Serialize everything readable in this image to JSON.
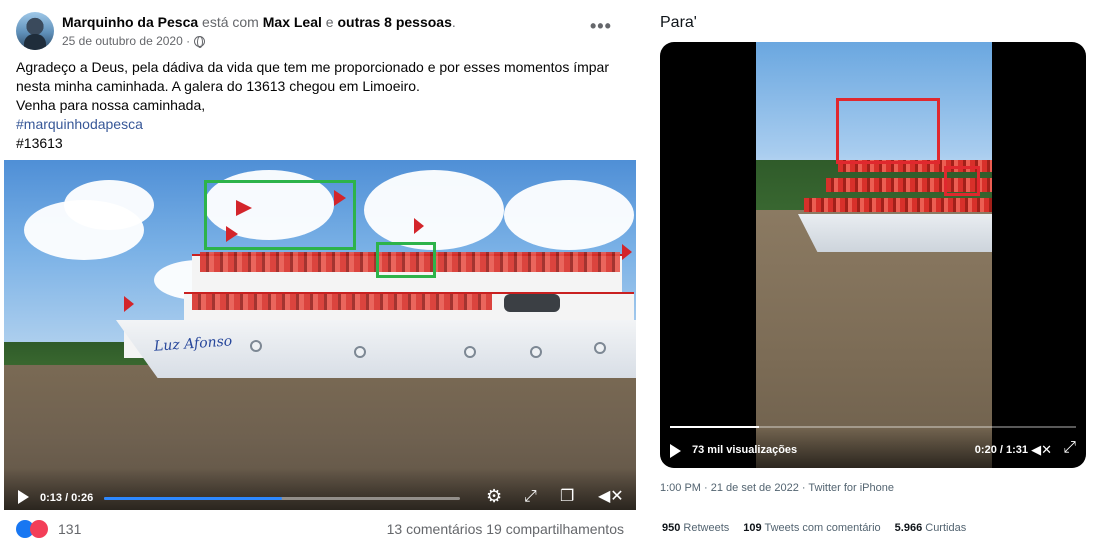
{
  "facebook_post": {
    "author": "Marquinho da Pesca",
    "with_text": "está com",
    "tagged": "Max Leal",
    "and_text": "e",
    "others": "outras 8 pessoas",
    "period": ".",
    "date": "25 de outubro de 2020 ·",
    "more_icon": "more-horizontal-icon",
    "text_lines": [
      "Agradeço a Deus, pela dádiva da vida que tem me proporcionado e por esses momentos ímpar",
      "nesta minha caminhada. A galera do 13613 chegou em Limoeiro.",
      "Venha para nossa caminhada,"
    ],
    "hashtag": "#marquinhodapesca",
    "number_tag": "#13613",
    "video": {
      "boat_name": "Luz Afonso",
      "time": "0:13 / 0:26",
      "progress": 0.5,
      "highlight_color": "#2db34a"
    },
    "reactions_count": "131",
    "comments": "13 comentários",
    "shares": "19 compartilhamentos",
    "colors": {
      "link": "#385898",
      "like": "#1877f2",
      "love": "#f33e58"
    }
  },
  "tweet": {
    "title": "Para'",
    "video": {
      "views": "73 mil visualizações",
      "time": "0:20 / 1:31",
      "progress": 0.22,
      "highlight_color": "#e0282e"
    },
    "meta": "1:00 PM · 21 de set de 2022 · Twitter for iPhone",
    "stats": [
      {
        "count": "950",
        "label": "Retweets"
      },
      {
        "count": "109",
        "label": "Tweets com comentário"
      },
      {
        "count": "5.966",
        "label": "Curtidas"
      }
    ]
  }
}
